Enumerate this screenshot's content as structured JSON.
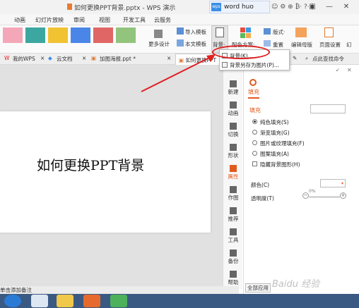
{
  "window": {
    "title": "如何更换PPT背景.pptx - WPS 演示",
    "word_box": "word huo",
    "small_icons": "☺ ⚙ ⊕ ₿· ?· |"
  },
  "menu": [
    "动画",
    "幻灯片放映",
    "审阅",
    "视图",
    "开发工具",
    "云服务"
  ],
  "ribbon": {
    "more_design": "更多设计",
    "import_template": "导入模板",
    "this_doc_template": "本文模板",
    "background": "背景·",
    "color_scheme": "配色方案·",
    "layout": "版式·",
    "reset": "重置",
    "edit_master": "编辑母版",
    "page_setup": "页面设置",
    "last": "幻"
  },
  "tabs": [
    {
      "label": "我的WPS"
    },
    {
      "label": "云文档"
    },
    {
      "label": "加图海报.ppt *"
    },
    {
      "label": "如何更换PPT"
    }
  ],
  "tab_search": "点此查找命令",
  "dropdown": {
    "items": [
      "背景(K)...",
      "背景另存为图片(P)..."
    ]
  },
  "slide": {
    "text": "如何更换PPT背景"
  },
  "side_tools": [
    "新建",
    "动画",
    "切换",
    "形状",
    "属性",
    "作图",
    "推荐",
    "工具",
    "备份",
    "帮助"
  ],
  "panel": {
    "tab": "填充",
    "section": "填充",
    "options": [
      "纯色填充(S)",
      "渐变填充(G)",
      "图片或纹理填充(F)",
      "图案填充(A)"
    ],
    "hide_bg": "隐藏背景图形(H)",
    "color_label": "颜色(C)",
    "transparency_label": "透明度(T)",
    "transparency_value": "0%",
    "apply_all": "全部应用"
  },
  "status": "单击添加备注",
  "watermark": "Baidu 经验"
}
